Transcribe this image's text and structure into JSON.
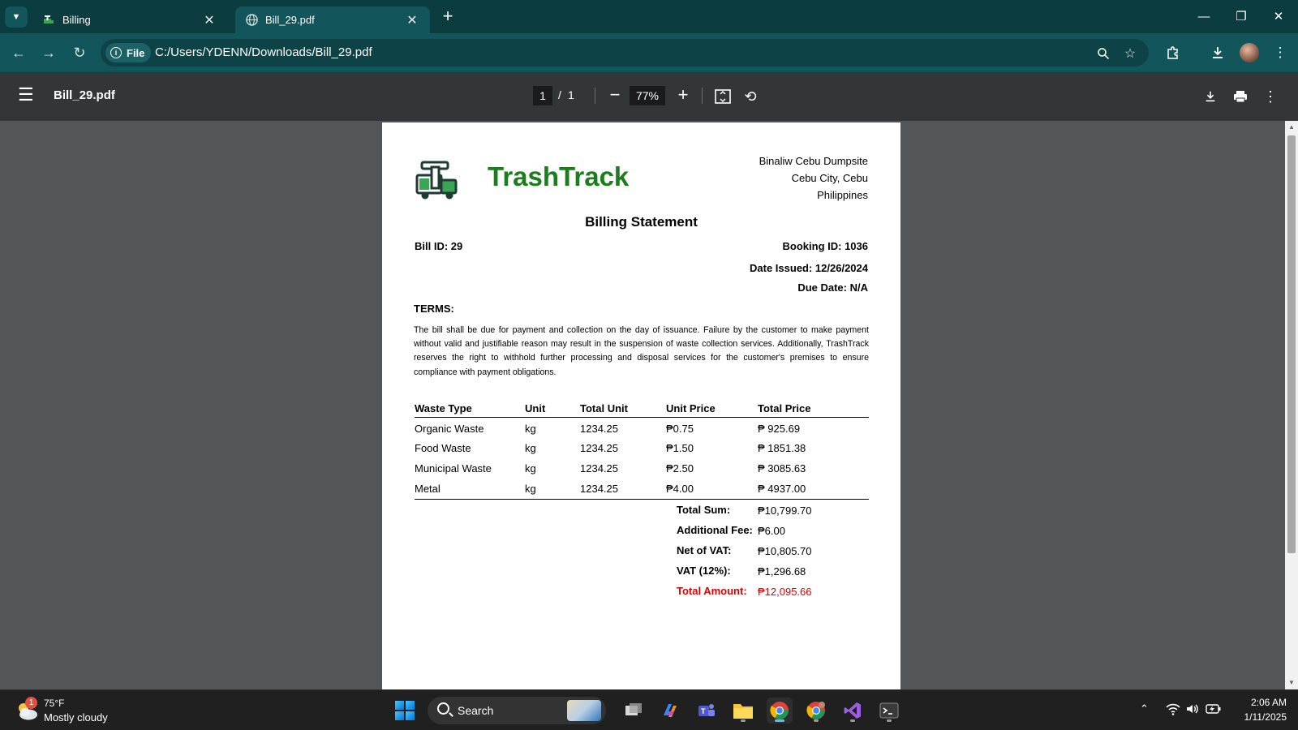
{
  "browser": {
    "tabs": [
      {
        "title": "Billing",
        "close": "✕"
      },
      {
        "title": "Bill_29.pdf",
        "close": "✕"
      }
    ],
    "new_tab": "+",
    "address": {
      "chip": "File",
      "url": "C:/Users/YDENN/Downloads/Bill_29.pdf"
    }
  },
  "pdf_toolbar": {
    "title": "Bill_29.pdf",
    "current_page": "1",
    "page_separator": "/",
    "total_pages": "1",
    "zoom": "77%"
  },
  "bill": {
    "brand": "TrashTrack",
    "brand_color": "#1b7d1b",
    "address_lines": [
      "Binaliw Cebu Dumpsite",
      "Cebu City, Cebu",
      "Philippines"
    ],
    "title": "Billing Statement",
    "bill_id": "Bill ID: 29",
    "booking_id": "Booking ID: 1036",
    "date_issued": "Date Issued: 12/26/2024",
    "due_date": "Due Date: N/A",
    "terms_heading": "TERMS:",
    "terms_text": "The bill shall be due for payment and collection on the day of issuance. Failure by the customer to make payment without valid and justifiable reason may result in the suspension of waste collection services. Additionally, TrashTrack reserves the right to withhold further processing and disposal services for the customer's premises to ensure compliance with payment obligations.",
    "table": {
      "headers": [
        "Waste Type",
        "Unit",
        "Total Unit",
        "Unit Price",
        "Total Price"
      ],
      "rows": [
        [
          "Organic Waste",
          "kg",
          "1234.25",
          "₱0.75",
          "₱ 925.69"
        ],
        [
          "Food Waste",
          "kg",
          "1234.25",
          "₱1.50",
          "₱ 1851.38"
        ],
        [
          "Municipal Waste",
          "kg",
          "1234.25",
          "₱2.50",
          "₱ 3085.63"
        ],
        [
          "Metal",
          "kg",
          "1234.25",
          "₱4.00",
          "₱ 4937.00"
        ]
      ]
    },
    "summary": [
      {
        "label": "Total Sum:",
        "value": "₱10,799.70"
      },
      {
        "label": "Additional Fee:",
        "value": "₱6.00"
      },
      {
        "label": "Net of VAT:",
        "value": "₱10,805.70"
      },
      {
        "label": "VAT (12%):",
        "value": "₱1,296.68"
      },
      {
        "label": "Total Amount:",
        "value": "₱12,095.66"
      }
    ],
    "total_color": "#e00000"
  },
  "taskbar": {
    "weather": {
      "badge": "1",
      "temp": "75°F",
      "desc": "Mostly cloudy"
    },
    "search_label": "Search",
    "apps": [
      "task-view",
      "copilot",
      "teams",
      "file-explorer",
      "chrome",
      "chrome-profile",
      "visual-studio",
      "terminal"
    ],
    "clock": {
      "time": "2:06 AM",
      "date": "1/11/2025"
    }
  }
}
